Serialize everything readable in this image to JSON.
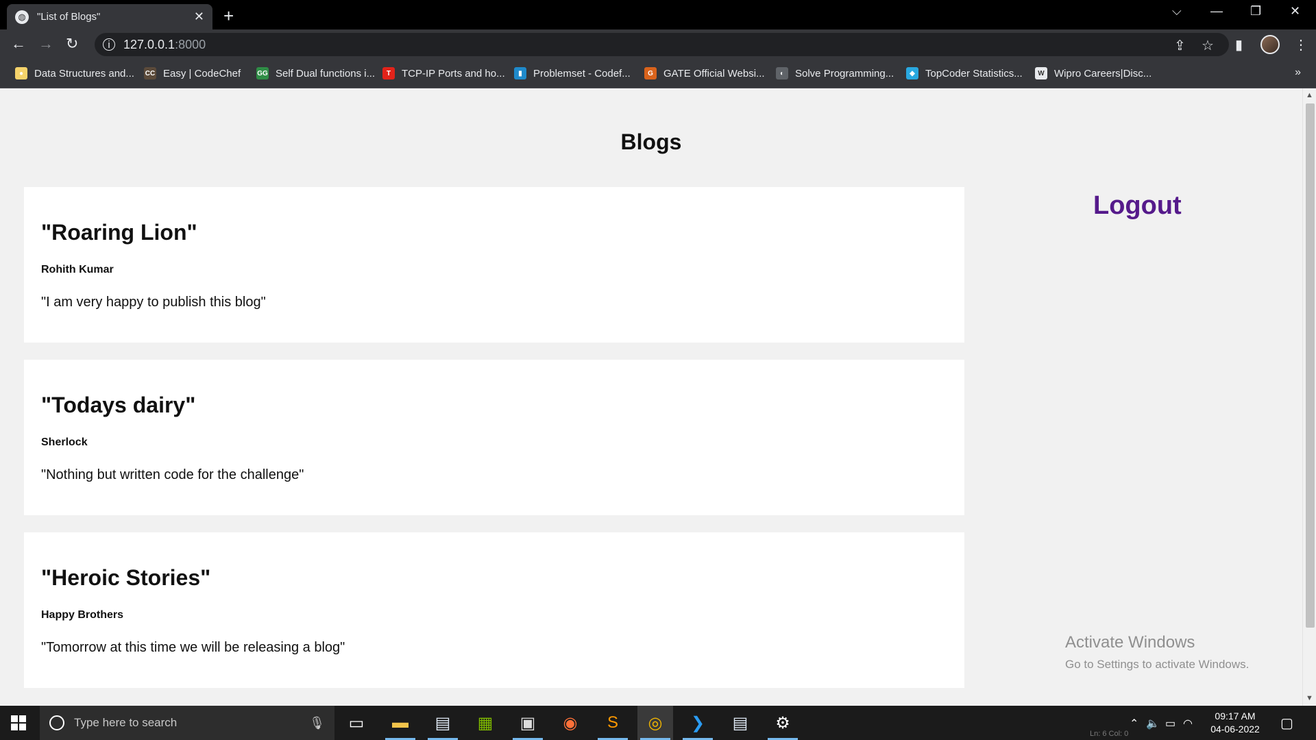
{
  "browser": {
    "tab_title": "\"List of Blogs\"",
    "tab_close": "✕",
    "new_tab": "+",
    "url_host": "127.0.0.1",
    "url_port": ":8000",
    "bookmarks": [
      {
        "label": "Data Structures and...",
        "color": "#f5d36b",
        "glyph": "●"
      },
      {
        "label": "Easy | CodeChef",
        "color": "#5b4a3a",
        "glyph": "CC"
      },
      {
        "label": "Self Dual functions i...",
        "color": "#2f8d46",
        "glyph": "GG"
      },
      {
        "label": "TCP-IP Ports and ho...",
        "color": "#e2231a",
        "glyph": "T"
      },
      {
        "label": "Problemset - Codef...",
        "color": "#1f8acb",
        "glyph": "▮"
      },
      {
        "label": "GATE Official Websi...",
        "color": "#d9631c",
        "glyph": "G"
      },
      {
        "label": "Solve Programming...",
        "color": "#5f6368",
        "glyph": "◐"
      },
      {
        "label": "TopCoder Statistics...",
        "color": "#29a8e0",
        "glyph": "◆"
      },
      {
        "label": "Wipro Careers|Disc...",
        "color": "#e8eaed",
        "glyph": "W"
      }
    ],
    "bookmarks_more": "»"
  },
  "page": {
    "title": "Blogs",
    "logout_label": "Logout",
    "blogs": [
      {
        "title": "\"Roaring Lion\"",
        "author": "Rohith Kumar",
        "body": "\"I am very happy to publish this blog\""
      },
      {
        "title": "\"Todays dairy\"",
        "author": "Sherlock",
        "body": "\"Nothing but written code for the challenge\""
      },
      {
        "title": "\"Heroic Stories\"",
        "author": "Happy Brothers",
        "body": "\"Tomorrow at this time we will be releasing a blog\""
      }
    ]
  },
  "watermark": {
    "line1": "Activate Windows",
    "line2": "Go to Settings to activate Windows."
  },
  "taskbar": {
    "search_placeholder": "Type here to search",
    "time": "09:17 AM",
    "date": "04-06-2022",
    "status_text": "Ln: 6   Col: 0"
  },
  "colors": {
    "link_visited": "#551a8b",
    "chrome_dark": "#35363a",
    "page_bg": "#f1f1f1"
  }
}
